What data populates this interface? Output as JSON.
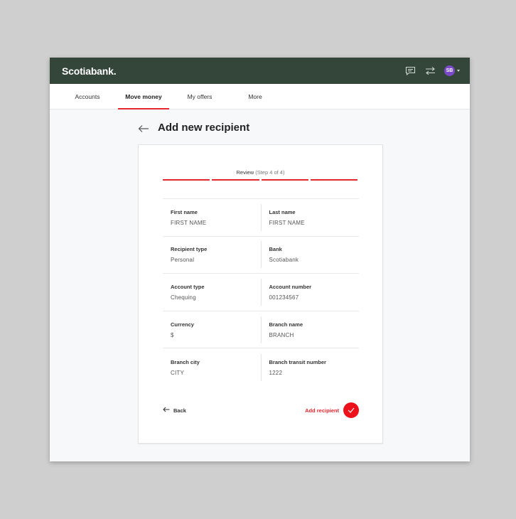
{
  "brand": {
    "logo": "Scotiabank.",
    "primary": "#334639",
    "accent": "#e4262d"
  },
  "header": {
    "icons": [
      "chat-icon",
      "transfer-icon"
    ],
    "avatar_initials": "SB",
    "avatar_color": "#7a49c6"
  },
  "nav": {
    "items": [
      {
        "label": "Accounts",
        "active": false
      },
      {
        "label": "Move money",
        "active": true
      },
      {
        "label": "My offers",
        "active": false
      },
      {
        "label": "More",
        "active": false
      }
    ]
  },
  "page": {
    "title": "Add new recipient"
  },
  "review": {
    "step_title": "Review",
    "step_sub": "(Step 4 of 4)",
    "rows": [
      {
        "left": {
          "label": "First name",
          "value": "FIRST NAME"
        },
        "right": {
          "label": "Last name",
          "value": "FIRST NAME"
        }
      },
      {
        "left": {
          "label": "Recipient type",
          "value": "Personal"
        },
        "right": {
          "label": "Bank",
          "value": "Scotiabank"
        }
      },
      {
        "left": {
          "label": "Account type",
          "value": "Chequing"
        },
        "right": {
          "label": "Account number",
          "value": "001234567"
        }
      },
      {
        "left": {
          "label": "Currency",
          "value": "$"
        },
        "right": {
          "label": "Branch name",
          "value": "BRANCH"
        }
      },
      {
        "left": {
          "label": "Branch city",
          "value": "CITY"
        },
        "right": {
          "label": "Branch transit number",
          "value": "1222"
        }
      }
    ]
  },
  "actions": {
    "back_label": "Back",
    "add_label": "Add recipient"
  }
}
